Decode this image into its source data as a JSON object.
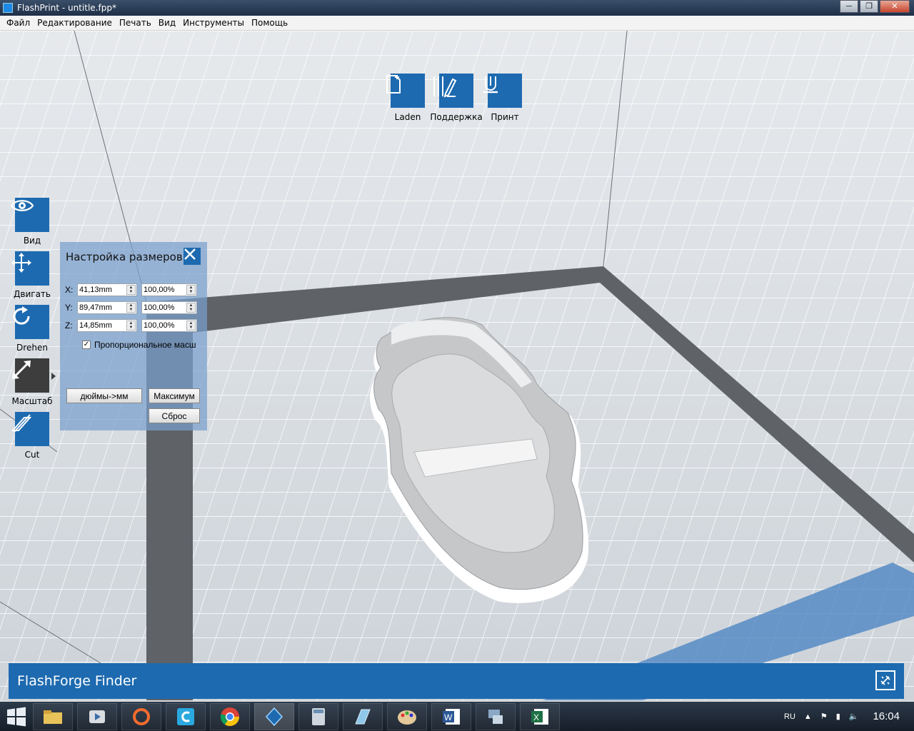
{
  "window": {
    "title": "FlashPrint - untitle.fpp*"
  },
  "menu": [
    "Файл",
    "Редактирование",
    "Печать",
    "Вид",
    "Инструменты",
    "Помощь"
  ],
  "top_toolbar": [
    {
      "label": "Laden",
      "icon": "load-file-icon"
    },
    {
      "label": "Поддержка",
      "icon": "support-pencil-icon"
    },
    {
      "label": "Принт",
      "icon": "print-icon"
    }
  ],
  "left_toolbar": [
    {
      "label": "Вид",
      "icon": "eye-icon"
    },
    {
      "label": "Двигать",
      "icon": "move-arrows-icon"
    },
    {
      "label": "Drehen",
      "icon": "rotate-icon"
    },
    {
      "label": "Масштаб",
      "icon": "scale-icon",
      "active": true
    },
    {
      "label": "Cut",
      "icon": "cut-icon"
    }
  ],
  "scale_panel": {
    "title": "Настройка размеров",
    "rows": [
      {
        "axis": "X:",
        "size": "41,13mm",
        "percent": "100,00%"
      },
      {
        "axis": "Y:",
        "size": "89,47mm",
        "percent": "100,00%"
      },
      {
        "axis": "Z:",
        "size": "14,85mm",
        "percent": "100,00%"
      }
    ],
    "proportional_label": "Пропорциональное масш",
    "proportional_checked": true,
    "inch_button": "дюймы->мм",
    "max_button": "Максимум",
    "reset_button": "Сброс"
  },
  "finder": {
    "title": "FlashForge Finder"
  },
  "taskbar": {
    "apps": [
      "file-explorer-icon",
      "media-player-icon",
      "origin-icon",
      "c-app-icon",
      "chrome-icon",
      "flashprint-icon",
      "calculator-icon",
      "editor-icon",
      "paint-icon",
      "word-icon",
      "network-icon",
      "excel-icon"
    ],
    "language": "RU",
    "time": "16:04"
  },
  "colors": {
    "accent": "#1d6ab0",
    "active_tool": "#3d3d3d",
    "build_border": "#5f6368"
  }
}
